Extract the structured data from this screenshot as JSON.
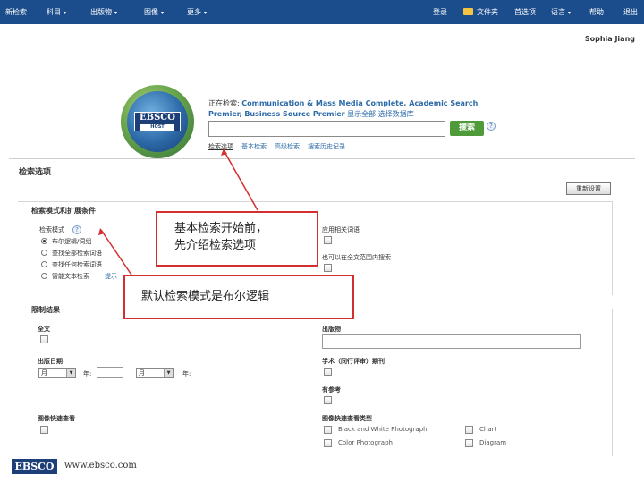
{
  "nav": {
    "left": [
      "新检索",
      "科目",
      "出版物",
      "图像",
      "更多"
    ],
    "right": [
      "登录",
      "文件夹",
      "首选项",
      "语言",
      "帮助",
      "退出"
    ]
  },
  "user": {
    "name": "Sophia Jiang"
  },
  "search": {
    "db_label": "正在检索:",
    "databases": "Communication & Mass Media Complete, Academic Search Premier, Business Source Premier",
    "show_all": "显示全部",
    "choose_db": "选择数据库",
    "button": "搜索",
    "help": "?",
    "tabs": [
      "检索选项",
      "基本检索",
      "高级检索",
      "搜索历史记录"
    ]
  },
  "options": {
    "title": "检索选项",
    "reset": "重新设置",
    "modes_title": "检索模式和扩展条件",
    "mode_label": "检索模式",
    "modes": [
      "布尔逻辑/词组",
      "查找全部检索词语",
      "查找任何检索词语",
      "智能文本检索"
    ],
    "hint": "提示",
    "apply_related": "应用相关词语",
    "also_fulltext": "也可以在全文范围内搜索"
  },
  "limits": {
    "title": "限制结果",
    "fulltext": "全文",
    "pub_date": "出版日期",
    "month1": "月",
    "month2": "月",
    "year1": "年:",
    "year2": "年:",
    "publication": "出版物",
    "peer_reviewed": "学术（同行评审）期刊",
    "references": "有参考",
    "image_quick_view": "图像快速查看",
    "image_types_title": "图像快速查看类型",
    "image_types": [
      "Black and White Photograph",
      "Chart",
      "Color Photograph",
      "Diagram"
    ]
  },
  "callouts": {
    "first_line1": "基本检索开始前，",
    "first_line2": "先介绍检索选项",
    "second": "默认检索模式是布尔逻辑"
  },
  "footer": {
    "logo": "EBSCO",
    "url": "www.ebsco.com"
  },
  "colors": {
    "nav": "#1b4d8c",
    "search_button": "#4f9b3a",
    "callout_border": "#d23030",
    "link": "#2b6aa8"
  }
}
